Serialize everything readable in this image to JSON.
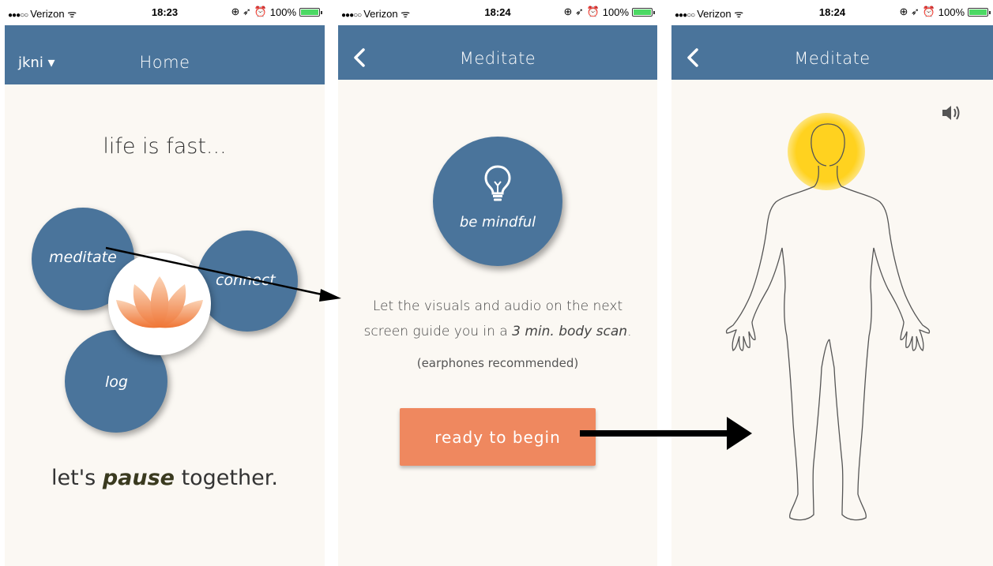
{
  "screens": [
    {
      "status": {
        "carrier": "Verizon",
        "time": "18:23",
        "battery": "100%"
      },
      "nav": {
        "user": "jkni ▾",
        "title": "Home"
      },
      "headline": "life is fast...",
      "circles": {
        "meditate": "meditate",
        "connect": "connect",
        "log": "log"
      },
      "tagline": {
        "before": "let's ",
        "emphasis": "pause",
        "after": " together."
      }
    },
    {
      "status": {
        "carrier": "Verizon",
        "time": "18:24",
        "battery": "100%"
      },
      "nav": {
        "title": "Meditate"
      },
      "mindful_label": "be mindful",
      "instruction": {
        "line1": "Let the visuals and audio on the next",
        "line2_before": "screen guide you in a ",
        "duration": "3 min.",
        "space": " ",
        "scan": "body scan",
        "period": "."
      },
      "note": "(earphones recommended)",
      "ready_button": "ready to begin"
    },
    {
      "status": {
        "carrier": "Verizon",
        "time": "18:24",
        "battery": "100%"
      },
      "nav": {
        "title": "Meditate"
      }
    }
  ],
  "colors": {
    "nav": "#4a749b",
    "accent_button": "#ef885f",
    "background": "#fbf8f3",
    "glow": "#ffd21f",
    "battery": "#4cd964"
  },
  "icons": [
    "wifi-icon",
    "location-icon",
    "alarm-icon",
    "battery-icon",
    "back-chevron-icon",
    "lotus-icon",
    "lightbulb-icon",
    "speaker-icon",
    "body-outline-icon",
    "arrow-icon"
  ]
}
